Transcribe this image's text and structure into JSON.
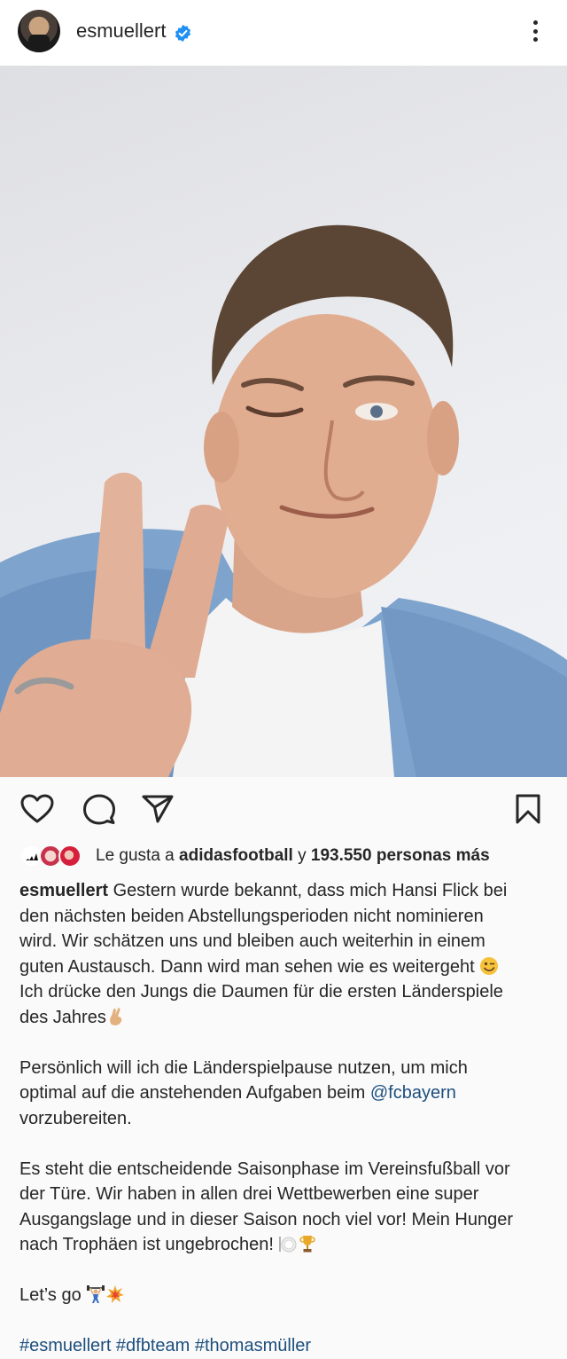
{
  "header": {
    "username": "esmuellert",
    "verified_color": "#1f8ff5"
  },
  "actions": {
    "icons": [
      "heart-icon",
      "comment-icon",
      "share-icon",
      "bookmark-icon"
    ]
  },
  "likes": {
    "prefix": "Le gusta a ",
    "account": "adidasfootball",
    "connector": " y ",
    "count": "193.550 personas más"
  },
  "caption": {
    "author": "esmuellert",
    "p1_l1": " Gestern wurde bekannt, dass mich Hansi Flick bei",
    "p1_l2": "den nächsten beiden Abstellungsperioden nicht nominieren",
    "p1_l3": "wird. Wir schätzen uns und bleiben auch weiterhin in einem",
    "p1_l4": "guten Austausch. Dann wird man sehen wie es weitergeht",
    "p1_l5": "Ich drücke den Jungs die Daumen für die ersten Länderspiele",
    "p1_l6": "des Jahres",
    "p2_l1": "Persönlich will ich die Länderspielpause nutzen, um mich",
    "p2_l2": "optimal auf die anstehenden Aufgaben beim ",
    "p2_mention": "@fcbayern",
    "p2_l3": "vorzubereiten.",
    "p3_l1": "Es steht die entscheidende Saisonphase im Vereinsfußball vor",
    "p3_l2": "der Türe. Wir haben in allen drei Wettbewerben eine super",
    "p3_l3": "Ausgangslage und in dieser Saison noch viel vor! Mein Hunger",
    "p3_l4": "nach Trophäen ist ungebrochen!",
    "p4_l1": "Let’s go",
    "hashtags": "#esmuellert #dfbteam #thomasmüller"
  },
  "emoji_icons": [
    "wink-emoji-icon",
    "crossed-fingers-emoji-icon",
    "plate-emoji-icon",
    "trophy-emoji-icon",
    "weightlifter-emoji-icon",
    "collision-emoji-icon"
  ]
}
